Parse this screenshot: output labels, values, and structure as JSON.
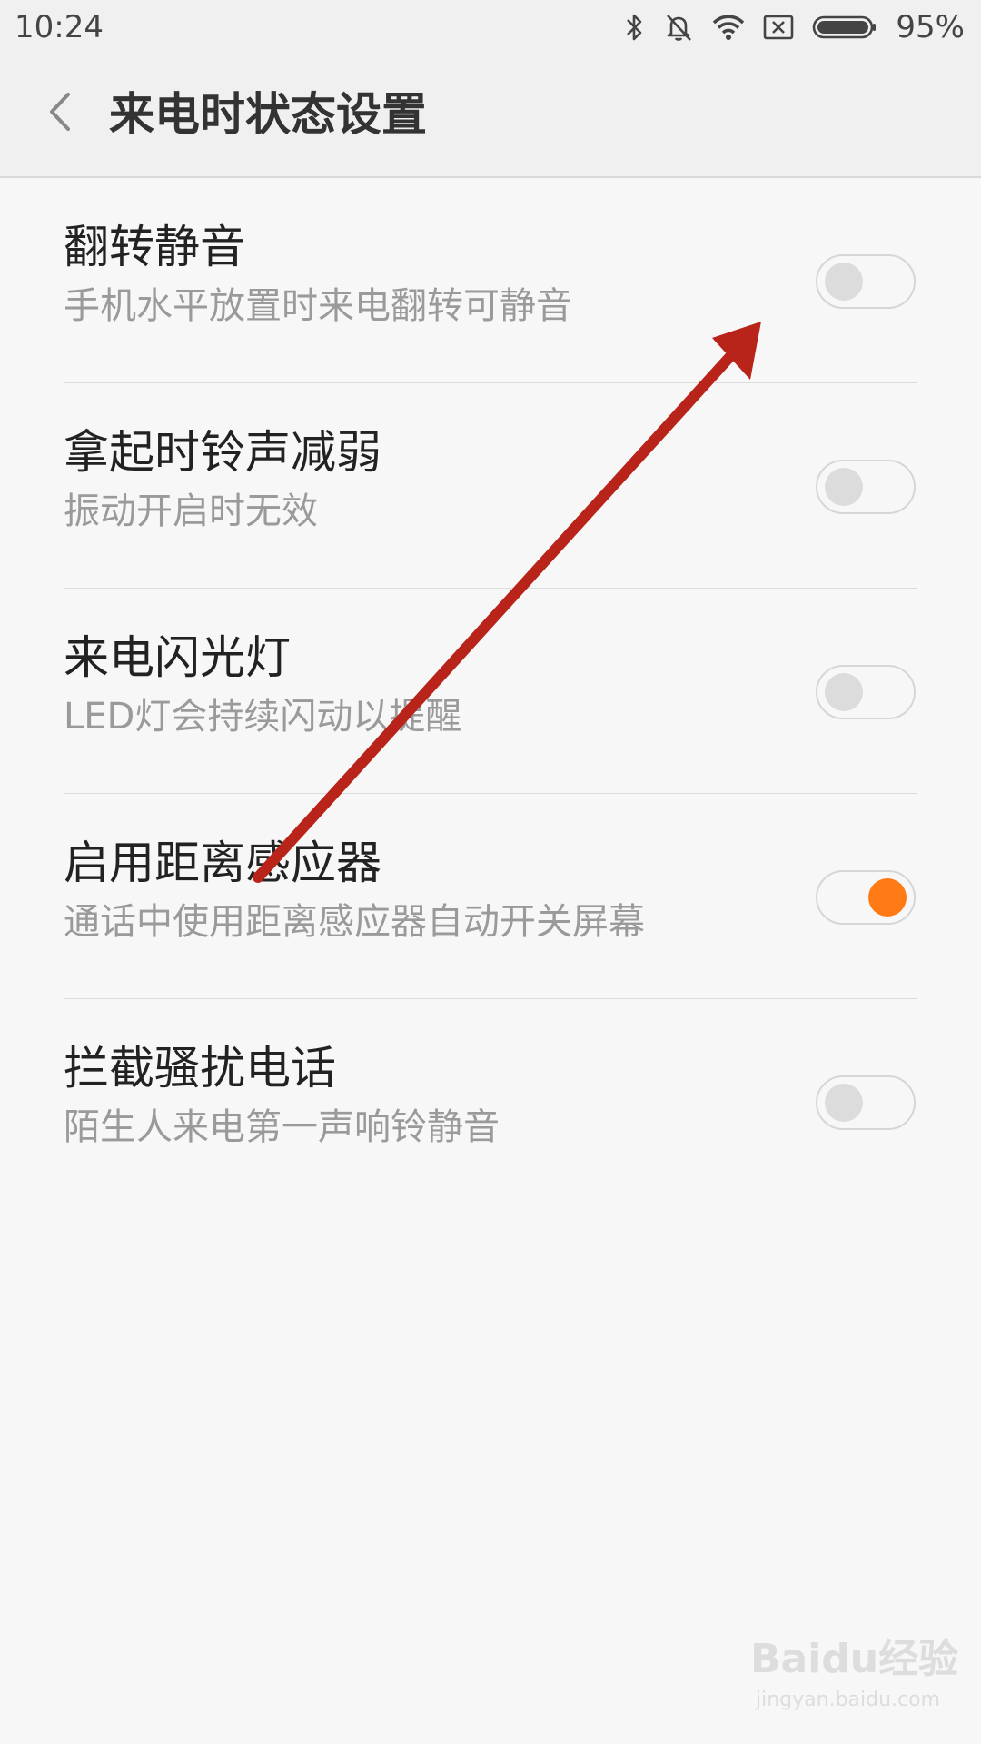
{
  "status_bar": {
    "time": "10:24",
    "battery_pct": "95%",
    "icons": [
      "bluetooth-icon",
      "mute-bell-icon",
      "wifi-icon",
      "sim-off-icon",
      "battery-icon"
    ]
  },
  "header": {
    "title": "来电时状态设置",
    "back_icon": "chevron-left-icon"
  },
  "settings": [
    {
      "title": "翻转静音",
      "subtitle": "手机水平放置时来电翻转可静音",
      "enabled": false
    },
    {
      "title": "拿起时铃声减弱",
      "subtitle": "振动开启时无效",
      "enabled": false
    },
    {
      "title": "来电闪光灯",
      "subtitle": "LED灯会持续闪动以提醒",
      "enabled": false
    },
    {
      "title": "启用距离感应器",
      "subtitle": "通话中使用距离感应器自动开关屏幕",
      "enabled": true
    },
    {
      "title": "拦截骚扰电话",
      "subtitle": "陌生人来电第一声响铃静音",
      "enabled": false
    }
  ],
  "colors": {
    "accent": "#ff7a14",
    "annotation_arrow": "#b8231a"
  },
  "watermark": {
    "logo": "Baidu经验",
    "url": "jingyan.baidu.com"
  }
}
